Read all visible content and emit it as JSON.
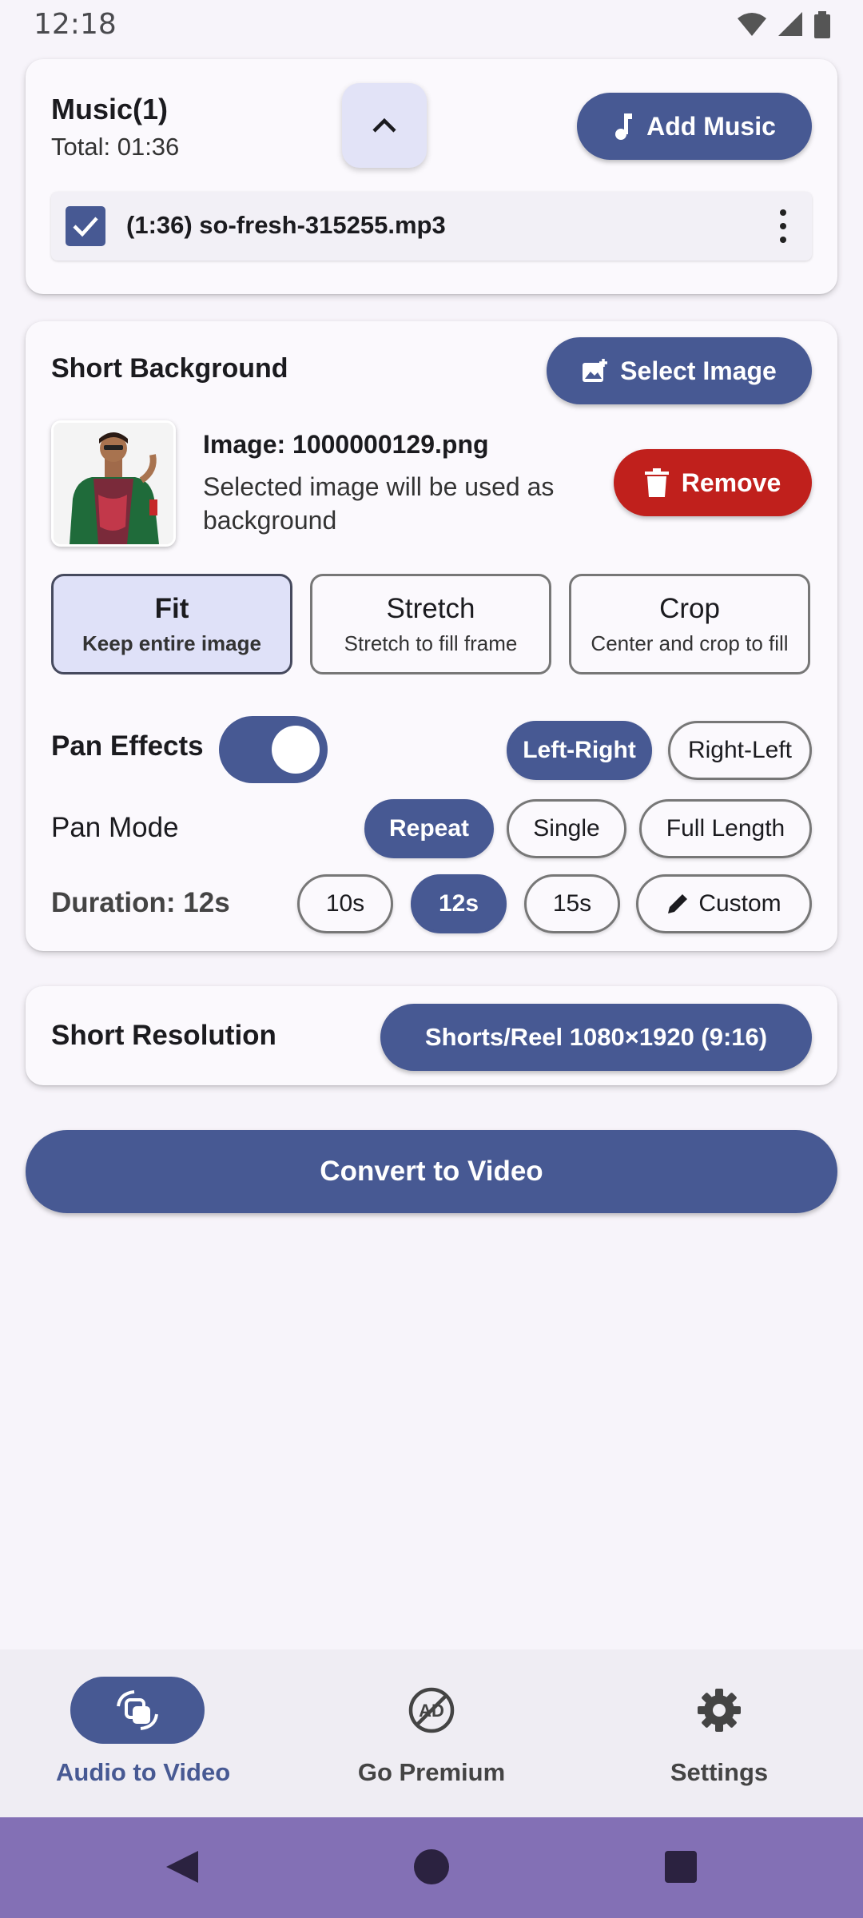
{
  "status_bar": {
    "time": "12:18",
    "icons": [
      "wifi-icon",
      "signal-icon",
      "battery-icon"
    ]
  },
  "music": {
    "title": "Music(1)",
    "total": "Total: 01:36",
    "add_music_label": "Add Music",
    "track": {
      "label": "(1:36) so-fresh-315255.mp3",
      "checked": true
    }
  },
  "background": {
    "title": "Short Background",
    "select_image_label": "Select Image",
    "image_name": "Image: 1000000129.png",
    "image_desc": "Selected image will be used as background",
    "remove_label": "Remove",
    "modes": [
      {
        "name": "Fit",
        "desc": "Keep entire image",
        "selected": true
      },
      {
        "name": "Stretch",
        "desc": "Stretch to fill frame",
        "selected": false
      },
      {
        "name": "Crop",
        "desc": "Center and crop to fill",
        "selected": false
      }
    ],
    "pan_effects": {
      "label": "Pan Effects",
      "enabled": true,
      "options": [
        "Left-Right",
        "Right-Left"
      ],
      "selected": "Left-Right"
    },
    "pan_mode": {
      "label": "Pan Mode",
      "options": [
        "Repeat",
        "Single",
        "Full Length"
      ],
      "selected": "Repeat"
    },
    "duration": {
      "label": "Duration: 12s",
      "options": [
        "10s",
        "12s",
        "15s",
        "Custom"
      ],
      "selected": "12s"
    }
  },
  "resolution": {
    "label": "Short Resolution",
    "value": "Shorts/Reel 1080×1920 (9:16)"
  },
  "convert_label": "Convert to Video",
  "bottom_nav": [
    {
      "label": "Audio to Video",
      "icon": "convert-icon",
      "active": true
    },
    {
      "label": "Go Premium",
      "icon": "no-ads-icon",
      "active": false
    },
    {
      "label": "Settings",
      "icon": "gear-icon",
      "active": false
    }
  ],
  "colors": {
    "primary": "#475993",
    "danger": "#c0201c",
    "selected_bg": "#dfe1f8",
    "system_nav": "#8370b5"
  }
}
